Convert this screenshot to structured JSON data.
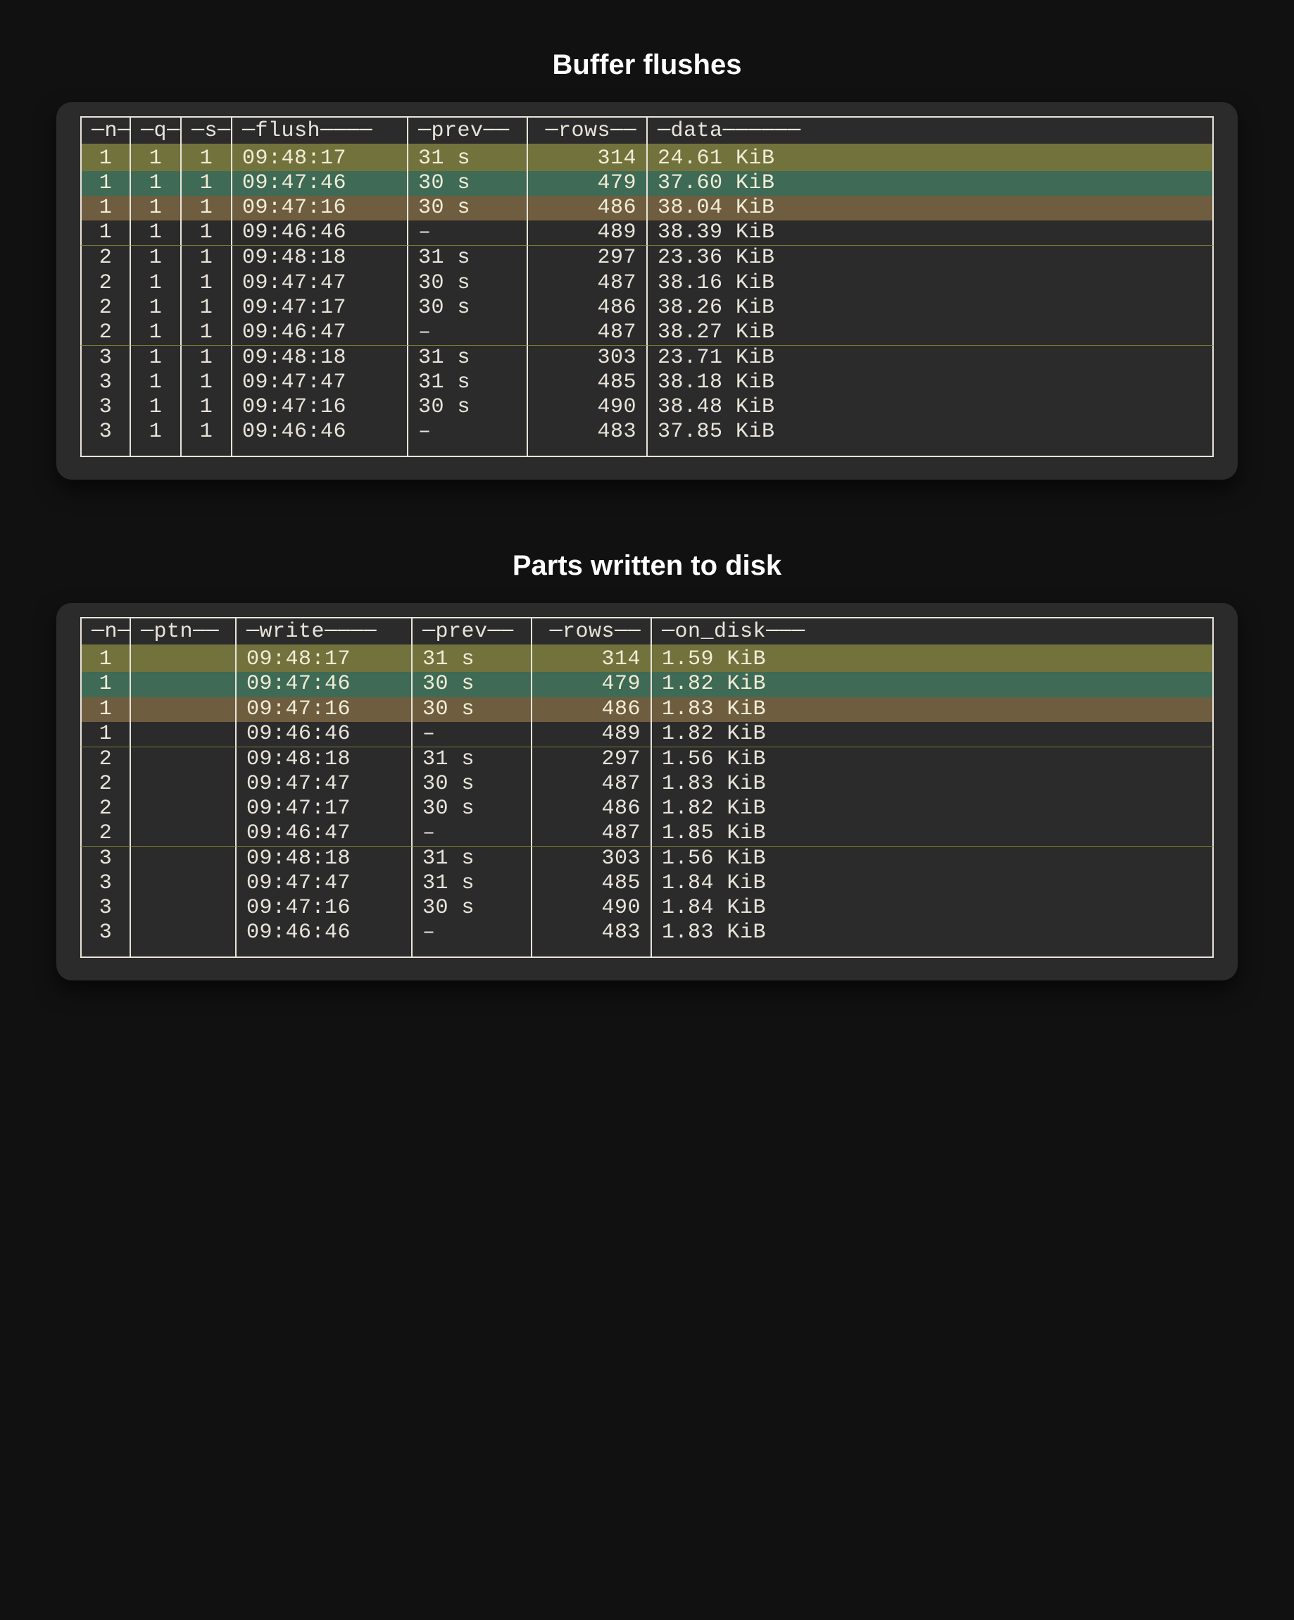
{
  "tables": [
    {
      "title": "Buffer flushes",
      "columns": [
        {
          "key": "n",
          "label": "─n─",
          "cls": "col-n"
        },
        {
          "key": "q",
          "label": "─q─",
          "cls": "col-aux"
        },
        {
          "key": "s",
          "label": "─s─",
          "cls": "col-aux2"
        },
        {
          "key": "flush",
          "label": "─flush────",
          "cls": "col-time"
        },
        {
          "key": "prev",
          "label": "─prev──",
          "cls": "col-prev"
        },
        {
          "key": "rows",
          "label": "─rows──",
          "cls": "col-rows"
        },
        {
          "key": "data",
          "label": "─data──────",
          "cls": "col-data"
        }
      ],
      "rows": [
        {
          "hl": "olive",
          "n": "1",
          "q": "1",
          "s": "1",
          "flush": "09:48:17",
          "prev": "31 s",
          "rows": "314",
          "data": "24.61 KiB"
        },
        {
          "hl": "green",
          "n": "1",
          "q": "1",
          "s": "1",
          "flush": "09:47:46",
          "prev": "30 s",
          "rows": "479",
          "data": "37.60 KiB"
        },
        {
          "hl": "brown",
          "n": "1",
          "q": "1",
          "s": "1",
          "flush": "09:47:16",
          "prev": "30 s",
          "rows": "486",
          "data": "38.04 KiB"
        },
        {
          "sep": true,
          "n": "1",
          "q": "1",
          "s": "1",
          "flush": "09:46:46",
          "prev": "–",
          "rows": "489",
          "data": "38.39 KiB"
        },
        {
          "n": "2",
          "q": "1",
          "s": "1",
          "flush": "09:48:18",
          "prev": "31 s",
          "rows": "297",
          "data": "23.36 KiB"
        },
        {
          "n": "2",
          "q": "1",
          "s": "1",
          "flush": "09:47:47",
          "prev": "30 s",
          "rows": "487",
          "data": "38.16 KiB"
        },
        {
          "n": "2",
          "q": "1",
          "s": "1",
          "flush": "09:47:17",
          "prev": "30 s",
          "rows": "486",
          "data": "38.26 KiB"
        },
        {
          "sep": true,
          "n": "2",
          "q": "1",
          "s": "1",
          "flush": "09:46:47",
          "prev": "–",
          "rows": "487",
          "data": "38.27 KiB"
        },
        {
          "n": "3",
          "q": "1",
          "s": "1",
          "flush": "09:48:18",
          "prev": "31 s",
          "rows": "303",
          "data": "23.71 KiB"
        },
        {
          "n": "3",
          "q": "1",
          "s": "1",
          "flush": "09:47:47",
          "prev": "31 s",
          "rows": "485",
          "data": "38.18 KiB"
        },
        {
          "n": "3",
          "q": "1",
          "s": "1",
          "flush": "09:47:16",
          "prev": "30 s",
          "rows": "490",
          "data": "38.48 KiB"
        },
        {
          "n": "3",
          "q": "1",
          "s": "1",
          "flush": "09:46:46",
          "prev": "–",
          "rows": "483",
          "data": "37.85 KiB"
        }
      ]
    },
    {
      "title": "Parts written to disk",
      "columns": [
        {
          "key": "n",
          "label": "─n─",
          "cls": "col-n"
        },
        {
          "key": "ptn",
          "label": "─ptn──",
          "cls": "col-tptn"
        },
        {
          "key": "write",
          "label": "─write────",
          "cls": "col-time"
        },
        {
          "key": "prev",
          "label": "─prev──",
          "cls": "col-prev"
        },
        {
          "key": "rows",
          "label": "─rows──",
          "cls": "col-rows"
        },
        {
          "key": "on_disk",
          "label": "─on_disk───",
          "cls": "col-data"
        }
      ],
      "rows": [
        {
          "hl": "olive",
          "n": "1",
          "ptn": "",
          "write": "09:48:17",
          "prev": "31 s",
          "rows": "314",
          "on_disk": "1.59 KiB"
        },
        {
          "hl": "green",
          "n": "1",
          "ptn": "",
          "write": "09:47:46",
          "prev": "30 s",
          "rows": "479",
          "on_disk": "1.82 KiB"
        },
        {
          "hl": "brown",
          "n": "1",
          "ptn": "",
          "write": "09:47:16",
          "prev": "30 s",
          "rows": "486",
          "on_disk": "1.83 KiB"
        },
        {
          "sep": true,
          "n": "1",
          "ptn": "",
          "write": "09:46:46",
          "prev": "–",
          "rows": "489",
          "on_disk": "1.82 KiB"
        },
        {
          "n": "2",
          "ptn": "",
          "write": "09:48:18",
          "prev": "31 s",
          "rows": "297",
          "on_disk": "1.56 KiB"
        },
        {
          "n": "2",
          "ptn": "",
          "write": "09:47:47",
          "prev": "30 s",
          "rows": "487",
          "on_disk": "1.83 KiB"
        },
        {
          "n": "2",
          "ptn": "",
          "write": "09:47:17",
          "prev": "30 s",
          "rows": "486",
          "on_disk": "1.82 KiB"
        },
        {
          "sep": true,
          "n": "2",
          "ptn": "",
          "write": "09:46:47",
          "prev": "–",
          "rows": "487",
          "on_disk": "1.85 KiB"
        },
        {
          "n": "3",
          "ptn": "",
          "write": "09:48:18",
          "prev": "31 s",
          "rows": "303",
          "on_disk": "1.56 KiB"
        },
        {
          "n": "3",
          "ptn": "",
          "write": "09:47:47",
          "prev": "31 s",
          "rows": "485",
          "on_disk": "1.84 KiB"
        },
        {
          "n": "3",
          "ptn": "",
          "write": "09:47:16",
          "prev": "30 s",
          "rows": "490",
          "on_disk": "1.84 KiB"
        },
        {
          "n": "3",
          "ptn": "",
          "write": "09:46:46",
          "prev": "–",
          "rows": "483",
          "on_disk": "1.83 KiB"
        }
      ]
    }
  ]
}
